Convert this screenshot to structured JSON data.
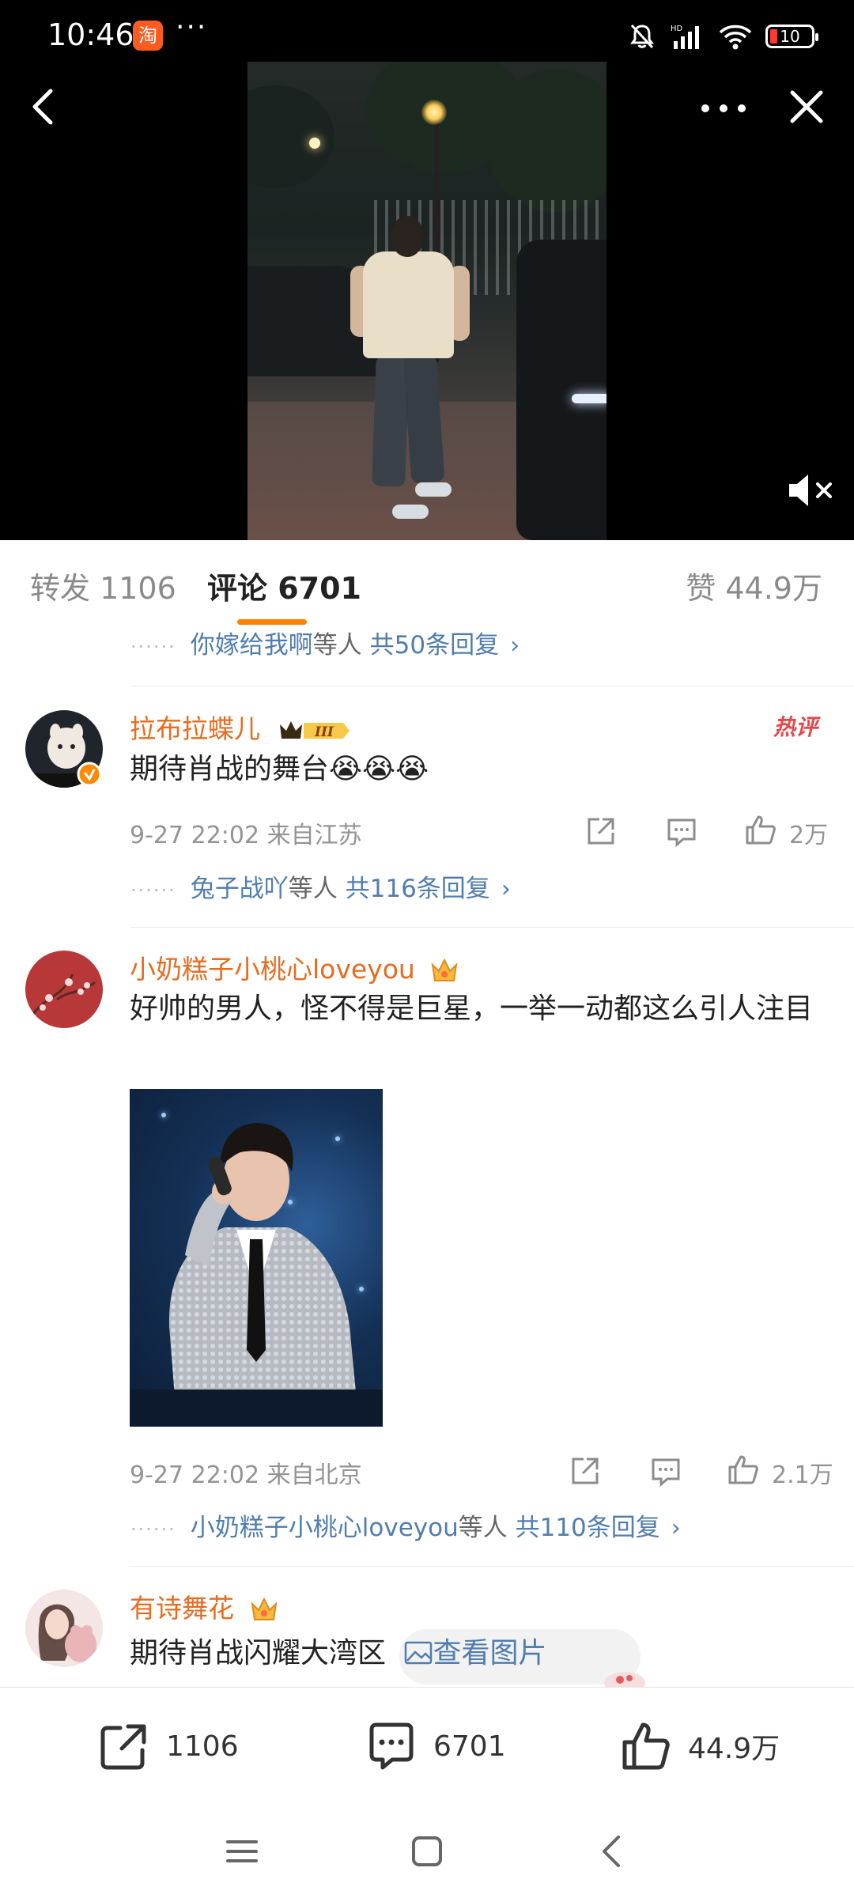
{
  "status_bar": {
    "time": "10:46",
    "taobao_icon_text": "淘",
    "more_dots": "···",
    "battery_level": "10",
    "icons": [
      "taobao-icon",
      "mute-notification-icon",
      "hd-signal-icon",
      "wifi-icon",
      "battery-icon"
    ]
  },
  "video": {
    "nav_icons": [
      "back-icon",
      "more-icon",
      "close-icon",
      "mute-volume-icon"
    ]
  },
  "tabs": {
    "repost": "转发 1106",
    "comment": "评论 6701",
    "like": "赞 44.9万",
    "active": "comment",
    "accent_color": "#ff8200"
  },
  "partial_reply": {
    "name": "你嫁给我啊",
    "suffix": "等人",
    "count": "共50条回复"
  },
  "comments": [
    {
      "username": "拉布拉蝶儿",
      "badge": "III",
      "hot_label": "热评",
      "text": "期待肖战的舞台😭😭😭",
      "time": "9-27 22:02",
      "location": "来自江苏",
      "likes": "2万",
      "reply_name": "兔子战吖",
      "reply_suffix": "等人",
      "reply_count": "共116条回复"
    },
    {
      "username": "小奶糕子小桃心loveyou",
      "text": "好帅的男人，怪不得是巨星，一举一动都这么引人注目",
      "time": "9-27 22:02",
      "location": "来自北京",
      "likes": "2.1万",
      "reply_name": "小奶糕子小桃心loveyou",
      "reply_suffix": "等人",
      "reply_count": "共110条回复"
    },
    {
      "username": "有诗舞花",
      "text": "期待肖战闪耀大湾区",
      "view_pic": "查看图片"
    }
  ],
  "bottom_bar": {
    "repost_count": "1106",
    "comment_count": "6701",
    "like_count": "44.9万"
  },
  "colors": {
    "username": "#e86b1f",
    "link": "#507daf",
    "hot": "#e8474a",
    "meta": "#939393"
  }
}
